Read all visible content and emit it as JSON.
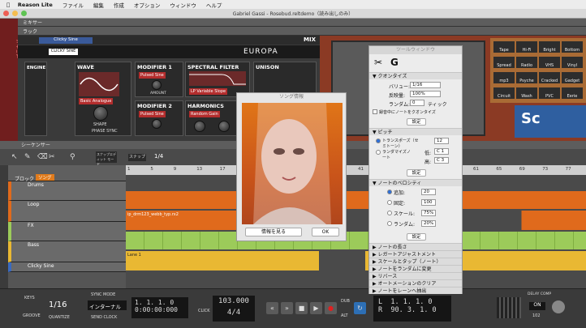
{
  "menubar": {
    "app": "Reason Lite",
    "items": [
      "ファイル",
      "編集",
      "作成",
      "オプション",
      "ウィンドウ",
      "ヘルプ"
    ]
  },
  "window": {
    "title": "Gabriel Gassi - Rosebud.reltdemo（読み出しのみ）"
  },
  "mixer": {
    "label": "ミキサー"
  },
  "rack": {
    "label": "ラック",
    "browser_label": "ブラウザー"
  },
  "europa": {
    "device_name": "Clicky Sine",
    "patch": "CLICKY SINE",
    "name": "EUROPA",
    "mix": "MIX",
    "engine": "ENGINE",
    "wave": "WAVE",
    "mod1": "MODIFIER 1",
    "mod2": "MODIFIER 2",
    "spectral": "SPECTRAL FILTER",
    "harmonics": "HARMONICS",
    "unison": "UNISON",
    "wave_sel": "Basic Analogue",
    "mod1_sel": "Pulsed Sine",
    "mod2_sel": "Pulsed Sine",
    "filter_sel": "LP Variable Slope",
    "harm_sel": "Random Gain",
    "amount": "AMOUNT",
    "shape": "SHAPE",
    "phase_sync": "PHASE SYNC",
    "vel": "VEL"
  },
  "synth": {
    "tapes": [
      "Tape",
      "Hi-Fi",
      "Bright",
      "Bottom",
      "Spread",
      "Radio",
      "VHS",
      "Vinyl",
      "mp3",
      "Psyche",
      "Cracked",
      "Gadget",
      "Circuit",
      "Wash",
      "PVC",
      "Eerie"
    ],
    "logo": "Sc",
    "cut": "CUT"
  },
  "sequencer": {
    "label": "シーケンサー",
    "quantize": "1/4",
    "snap": "スナップ",
    "mode": "スナップエディット モード",
    "bars": [
      "1",
      "5",
      "9",
      "13",
      "17",
      "21",
      "25",
      "29",
      "33",
      "37",
      "41",
      "45",
      "49",
      "53",
      "57",
      "61",
      "65",
      "69",
      "73",
      "77"
    ]
  },
  "tracks": [
    {
      "name": "ブロック",
      "sub": "ソング"
    },
    {
      "name": "Drums"
    },
    {
      "name": "Loop",
      "clip": "ip_drm123_webb_typ.rx2"
    },
    {
      "name": "FX"
    },
    {
      "name": "Bass",
      "clip": "Lane 1"
    },
    {
      "name": "Clicky Sine"
    }
  ],
  "transport": {
    "keys": "KEYS",
    "groove": "GROOVE",
    "quantize_val": "1/16",
    "quantize_lbl": "QUANTIZE",
    "sync_mode": "SYNC MODE",
    "sync_val": "インターナル",
    "send_clock": "SEND CLOCK",
    "pos1": "1. 1. 1.   0",
    "pos2": "0:00:00:000",
    "tempo": "103.000",
    "tap": "TAP",
    "sig": "4/4",
    "click": "CLICK",
    "pre": "PRE",
    "dub": "DUB",
    "alt": "ALT",
    "loop1": "1. 1. 1.   0",
    "loop2": "90. 3. 1.   0",
    "l": "L",
    "r": "R",
    "delay_comp": "DELAY COMP",
    "on": "ON",
    "val": "102",
    "dsp": "DSP",
    "calc": "CALC",
    "in": "IN",
    "out": "OUT"
  },
  "tool_window": {
    "title": "ツールウィンドウ",
    "quantize": "クオンタイズ",
    "value_lbl": "バリュー:",
    "value": "1/16",
    "amount_lbl": "反映量:",
    "amount": "100%",
    "random_lbl": "ランダム:",
    "random": "0",
    "tick": "ティック",
    "on_record": "録音中にノートをクオンタイズ",
    "setting": "設定",
    "pitch": "ピッチ",
    "transpose": "トランスポーズ（セミトーン）",
    "transpose_val": "12",
    "randomize": "ランダマイズノート",
    "low": "低:",
    "low_val": "C 1",
    "high": "高:",
    "high_val": "C 3",
    "velocity": "ノートのベロシティ",
    "add": "追加:",
    "add_val": "20",
    "fixed": "固定:",
    "fixed_val": "100",
    "scale": "スケール:",
    "scale_val": "75%",
    "vrandom": "ランダム:",
    "vrandom_val": "20%",
    "sections": [
      "ノートの長さ",
      "レガートアジャストメント",
      "スケールとタップ（ノート）",
      "ノートをランダムに変更",
      "リバース",
      "オートメーションのクリア",
      "ノートをレーンへ抽出"
    ]
  },
  "song_info": {
    "title": "ソング情報",
    "more": "情報を見る",
    "ok": "OK"
  }
}
